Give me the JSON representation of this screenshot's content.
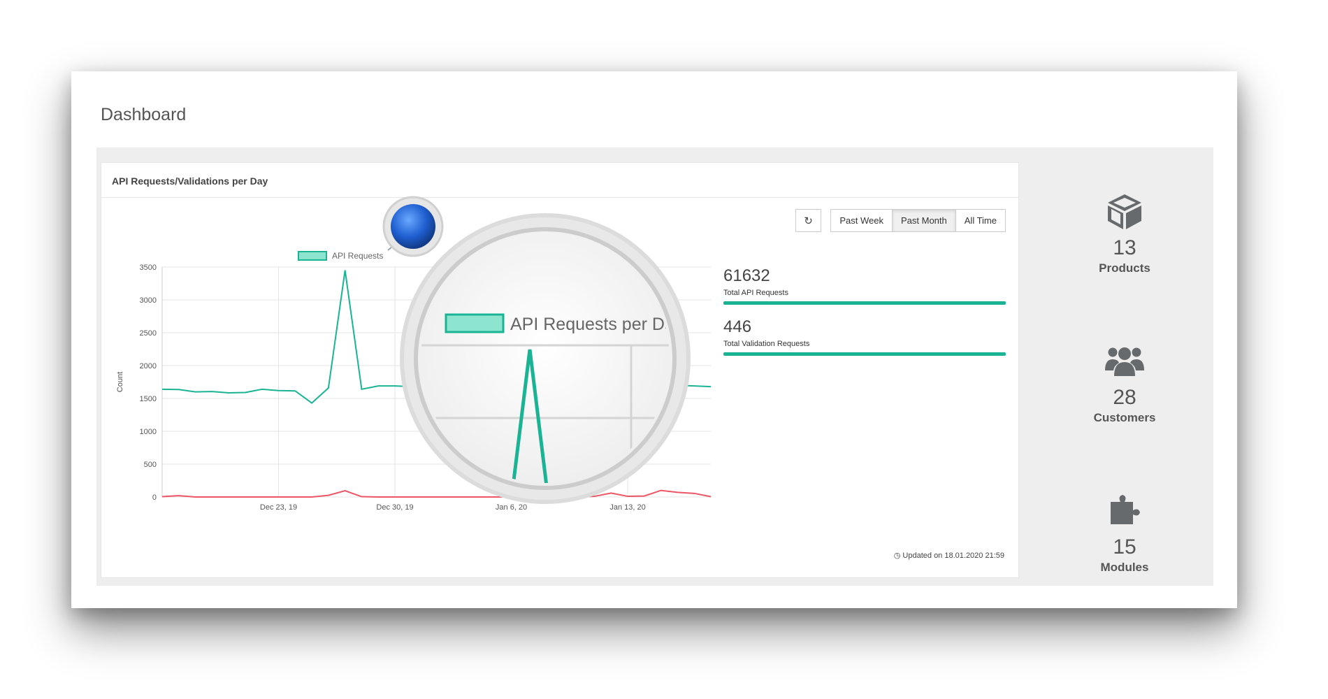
{
  "page": {
    "title": "Dashboard"
  },
  "panel": {
    "title": "API Requests/Validations per Day",
    "refresh_icon": "refresh-icon",
    "buttons": [
      {
        "label": "Past Week",
        "active": false
      },
      {
        "label": "Past Month",
        "active": true
      },
      {
        "label": "All Time",
        "active": false
      }
    ],
    "updated_text": "Updated on 18.01.2020 21:59",
    "clock_icon": "clock-icon"
  },
  "stats": [
    {
      "value": "61632",
      "label": "Total API Requests"
    },
    {
      "value": "446",
      "label": "Total Validation Requests"
    }
  ],
  "sidebar": [
    {
      "icon": "cube-icon",
      "count": "13",
      "label": "Products"
    },
    {
      "icon": "users-icon",
      "count": "28",
      "label": "Customers"
    },
    {
      "icon": "puzzle-icon",
      "count": "15",
      "label": "Modules"
    }
  ],
  "magnifier": {
    "legend_text": "API Requests per Day"
  },
  "chart_data": {
    "type": "line",
    "ylabel": "Count",
    "ylim": [
      0,
      3500
    ],
    "yticks": [
      "3500",
      "3000",
      "2500",
      "2000",
      "1500",
      "1000",
      "500",
      "0"
    ],
    "xtick_labels": [
      "Dec 23, 19",
      "Dec 30, 19",
      "Jan 6, 20",
      "Jan 13, 20"
    ],
    "legend": [
      "API Requests"
    ],
    "colors": {
      "requests": "#1ab394",
      "validations": "#ed5565"
    },
    "x_dates": [
      "2019-12-16",
      "2019-12-17",
      "2019-12-18",
      "2019-12-19",
      "2019-12-20",
      "2019-12-21",
      "2019-12-22",
      "2019-12-23",
      "2019-12-24",
      "2019-12-25",
      "2019-12-26",
      "2019-12-27",
      "2019-12-28",
      "2019-12-29",
      "2019-12-30",
      "2019-12-31",
      "2020-01-01",
      "2020-01-02",
      "2020-01-03",
      "2020-01-04",
      "2020-01-05",
      "2020-01-06",
      "2020-01-07",
      "2020-01-08",
      "2020-01-09",
      "2020-01-10",
      "2020-01-11",
      "2020-01-12",
      "2020-01-13",
      "2020-01-14",
      "2020-01-15",
      "2020-01-16",
      "2020-01-17",
      "2020-01-18"
    ],
    "series": [
      {
        "name": "API Requests",
        "values": [
          1640,
          1635,
          1600,
          1605,
          1585,
          1590,
          1640,
          1620,
          1615,
          1430,
          1660,
          3450,
          1640,
          1690,
          1690,
          1680,
          1700,
          1710,
          1690,
          1705,
          1700,
          1695,
          2350,
          1700,
          1690,
          1700,
          1680,
          1695,
          1700,
          1690,
          1685,
          1700,
          1690,
          1680
        ]
      },
      {
        "values": [
          5,
          20,
          0,
          0,
          0,
          0,
          0,
          0,
          0,
          0,
          25,
          95,
          5,
          0,
          0,
          0,
          0,
          0,
          0,
          0,
          0,
          0,
          0,
          0,
          0,
          0,
          10,
          60,
          10,
          15,
          100,
          70,
          55,
          5
        ]
      }
    ]
  }
}
